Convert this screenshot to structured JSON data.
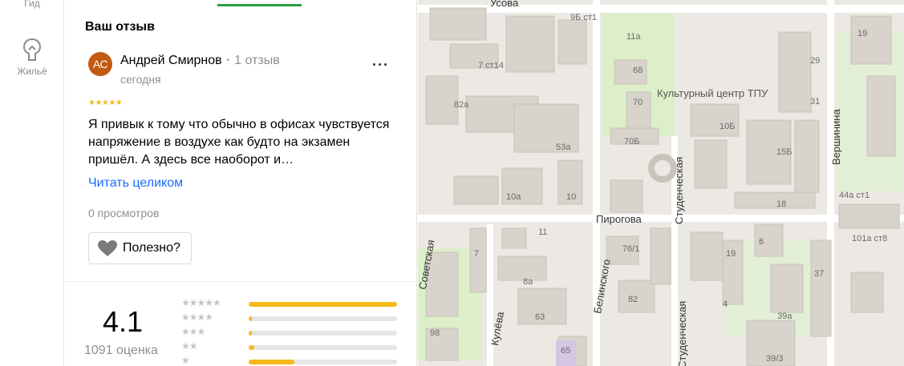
{
  "rail": {
    "gid_label": "Гид",
    "zhile_label": "Жильё"
  },
  "review": {
    "section_title": "Ваш отзыв",
    "avatar_initials": "АС",
    "author_name": "Андрей Смирнов",
    "author_separator": "•",
    "author_reviews": "1 отзыв",
    "date": "сегодня",
    "stars": "★★★★★",
    "text": "Я привык к тому что обычно в офисах чувствуется напряжение в воздухе как будто на экзамен пришёл. А здесь все наоборот и…",
    "read_more": "Читать целиком",
    "views": "0 просмотров",
    "useful_label": "Полезно?"
  },
  "rating": {
    "value": "4.1",
    "count": "1091 оценка",
    "distribution": [
      {
        "stars": "★★★★★",
        "fraction": 1.0
      },
      {
        "stars": "★★★★",
        "fraction": 0.02
      },
      {
        "stars": "★★★",
        "fraction": 0.02
      },
      {
        "stars": "★★",
        "fraction": 0.04
      },
      {
        "stars": "★",
        "fraction": 0.31
      }
    ]
  },
  "map": {
    "streets": {
      "usova": "Усова",
      "pirogova": "Пирогова",
      "studencheskaya": "Студенческая",
      "studencheskaya_2": "Студенческая",
      "vershinina": "Вершинина",
      "belinskogo": "Белинского",
      "kulyova": "Кулёва",
      "sovetskaya": "Советская"
    },
    "poi": {
      "culture_center": "Культурный центр ТПУ"
    },
    "numbers": [
      "9Б ст1",
      "11а",
      "7 ст14",
      "68",
      "82а",
      "70",
      "53а",
      "70Б",
      "10Б",
      "15Б",
      "10а",
      "10",
      "18",
      "44а ст1",
      "29",
      "31",
      "19",
      "101а ст8",
      "11",
      "76/1",
      "6",
      "7",
      "8а",
      "19",
      "37",
      "82",
      "4",
      "39а",
      "63",
      "98",
      "65",
      "39/3"
    ]
  },
  "colors": {
    "accent_green": "#2a9e3f",
    "link_blue": "#196dff",
    "star_yellow": "#f7b81c",
    "avatar_bg": "#c25a12"
  }
}
